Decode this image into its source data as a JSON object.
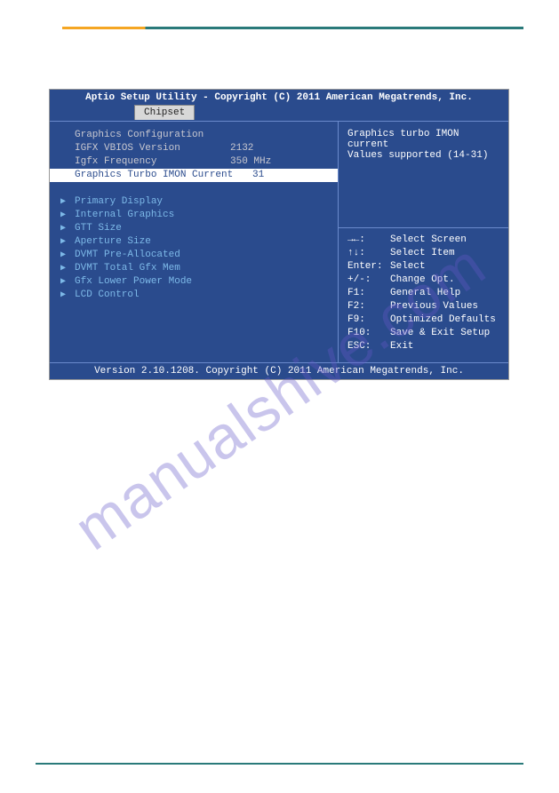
{
  "watermark": "manualshive.com",
  "bios": {
    "title": "Aptio Setup Utility - Copyright (C) 2011 American Megatrends, Inc.",
    "tab": "Chipset",
    "footer": "Version 2.10.1208. Copyright (C) 2011 American Megatrends, Inc.",
    "section_header": "Graphics Configuration",
    "info": [
      {
        "label": "IGFX VBIOS Version",
        "value": "2132"
      },
      {
        "label": "Igfx Frequency",
        "value": "350 MHz"
      }
    ],
    "selected": {
      "label": "Graphics Turbo IMON Current",
      "value": "31"
    },
    "menu": [
      "Primary Display",
      "Internal Graphics",
      "GTT Size",
      "Aperture Size",
      "DVMT Pre-Allocated",
      "DVMT Total Gfx Mem",
      "Gfx Lower Power Mode",
      "LCD Control"
    ],
    "help": {
      "line1": "Graphics turbo IMON current",
      "line2": "Values supported (14-31)"
    },
    "keys": [
      {
        "k": "→←:",
        "d": "Select Screen"
      },
      {
        "k": "↑↓:",
        "d": "Select Item"
      },
      {
        "k": "Enter:",
        "d": "Select"
      },
      {
        "k": "+/-:",
        "d": "Change Opt."
      },
      {
        "k": "F1:",
        "d": "General Help"
      },
      {
        "k": "F2:",
        "d": "Previous Values"
      },
      {
        "k": "F9:",
        "d": "Optimized Defaults"
      },
      {
        "k": "F10:",
        "d": "Save & Exit Setup"
      },
      {
        "k": "ESC:",
        "d": "Exit"
      }
    ]
  }
}
